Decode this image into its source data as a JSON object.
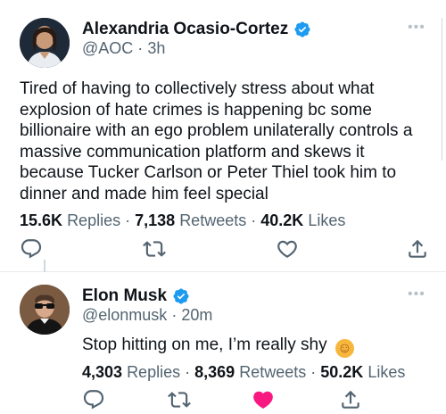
{
  "tweets": [
    {
      "name": "Alexandria Ocasio-Cortez",
      "handle": "@AOC",
      "time": "3h",
      "text": "Tired of having to collectively stress about what explosion of hate crimes is happening bc some billionaire with an ego problem unilaterally controls a massive communication platform and skews it because Tucker Carlson or Peter Thiel took him to dinner and made him feel special",
      "replies": "15.6K",
      "replies_label": "Replies",
      "retweets": "7,138",
      "retweets_label": "Retweets",
      "likes": "40.2K",
      "likes_label": "Likes",
      "liked": false
    },
    {
      "name": "Elon Musk",
      "handle": "@elonmusk",
      "time": "20m",
      "text": "Stop hitting on me, I’m really shy",
      "emoji": "☺",
      "replies": "4,303",
      "replies_label": "Replies",
      "retweets": "8,369",
      "retweets_label": "Retweets",
      "likes": "50.2K",
      "likes_label": "Likes",
      "liked": true
    }
  ],
  "separator": "·",
  "colors": {
    "verified": "#1d9bf0",
    "liked": "#f91880",
    "secondary": "#536471",
    "icon": "#536471"
  },
  "icons": {
    "reply": "reply-icon",
    "retweet": "retweet-icon",
    "like": "heart-icon",
    "share": "share-icon",
    "more": "more-icon",
    "verified": "verified-badge-icon"
  }
}
